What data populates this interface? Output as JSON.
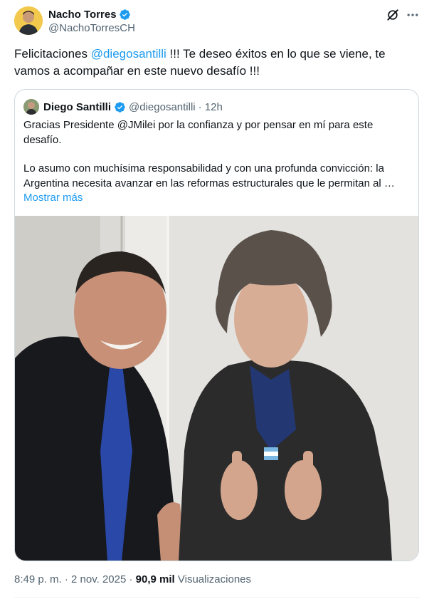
{
  "tweet": {
    "author": {
      "name": "Nacho Torres",
      "handle": "@NachoTorresCH",
      "verified": true
    },
    "text": {
      "part1": "Felicitaciones ",
      "mention": "@diegosantilli",
      "part2": " !!! Te deseo éxitos en lo que se viene, te vamos a acompañar en este nuevo desafío !!!"
    },
    "timestamp": "8:49 p. m. · 2 nov. 2025",
    "separator": " · ",
    "views_count": "90,9 mil",
    "views_label": " Visualizaciones",
    "icons": [
      "verified-badge-icon",
      "grok-icon",
      "more-options-icon"
    ]
  },
  "quoted": {
    "author": {
      "name": "Diego Santilli",
      "handle": "@diegosantilli",
      "time": "· 12h",
      "verified": true
    },
    "paragraph1": "Gracias Presidente @JMilei por la confianza y por pensar en mí para este desafío.",
    "paragraph2": "Lo asumo con muchísima responsabilidad y con una profunda convicción: la Argentina necesita avanzar en las reformas estructurales que le permitan al …",
    "show_more": "Mostrar más"
  },
  "colors": {
    "accent": "#1d9bf0",
    "text": "#0f1419",
    "secondary": "#536471",
    "border": "#cfd9de"
  }
}
